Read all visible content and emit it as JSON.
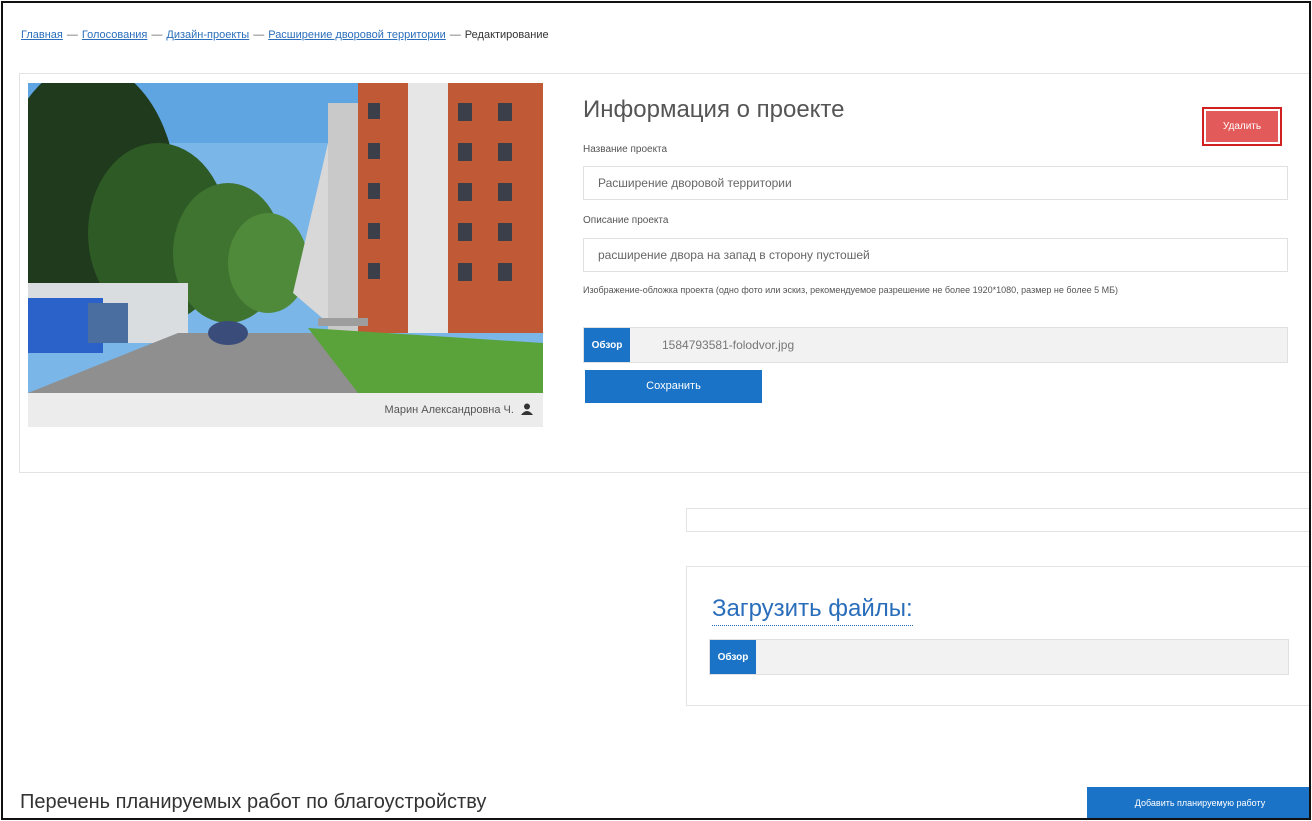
{
  "breadcrumb": {
    "items": [
      "Главная",
      "Голосования",
      "Дизайн-проекты",
      "Расширение дворовой территории"
    ],
    "current": "Редактирование",
    "separator": "—"
  },
  "photo": {
    "caption": "Марин Александровна Ч.",
    "user_icon": "user-icon"
  },
  "project_info": {
    "title": "Информация о проекте",
    "delete_label": "Удалить",
    "name_label": "Название проекта",
    "name_value": "Расширение дворовой территории",
    "description_label": "Описание проекта",
    "description_value": "расширение двора на запад в сторону пустошей",
    "image_hint": "Изображение-обложка проекта (одно фото или эскиз, рекомендуемое разрешение не более 1920*1080, размер не более 5 МБ)",
    "browse_label": "Обзор",
    "file_name": "1584793581-folodvor.jpg",
    "save_label": "Сохранить"
  },
  "upload": {
    "title": "Загрузить файлы:",
    "browse_label": "Обзор"
  },
  "works": {
    "title": "Перечень планируемых работ по благоустройству",
    "add_label": "Добавить планируемую работу"
  },
  "colors": {
    "primary": "#1a73c7",
    "danger": "#e25a5a",
    "danger_border": "#d02020",
    "link": "#2a6ebb"
  }
}
